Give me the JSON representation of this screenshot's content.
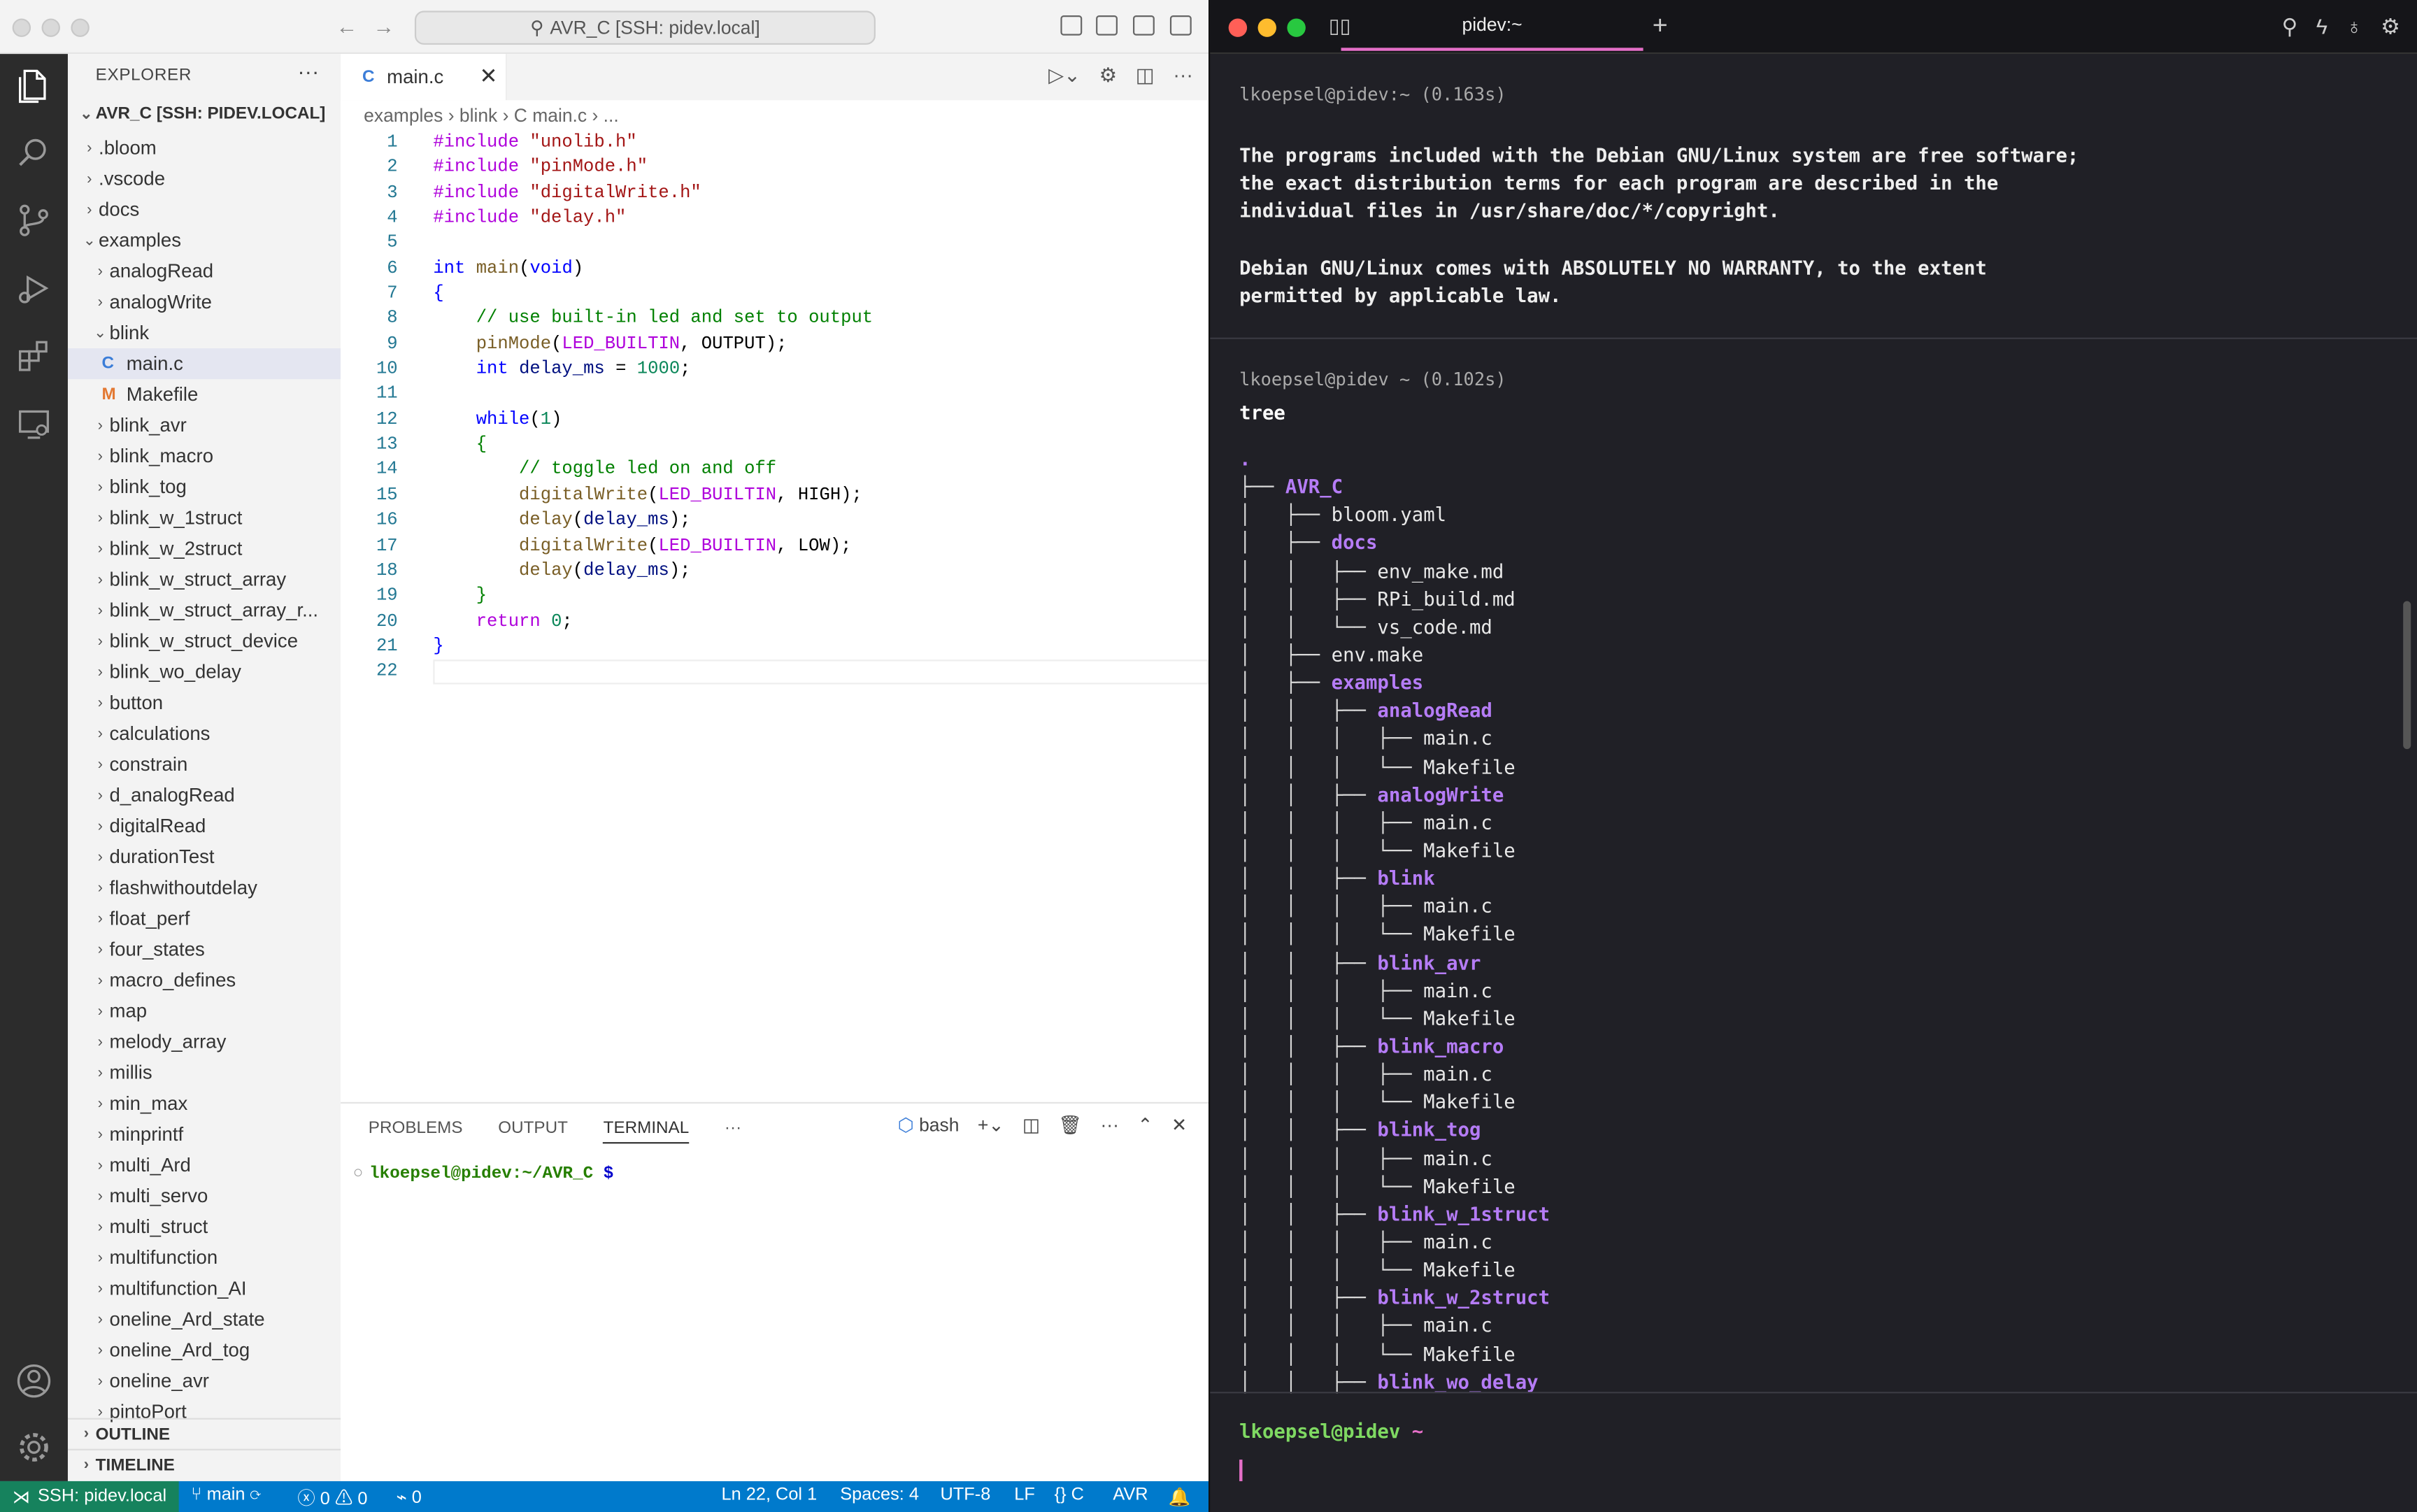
{
  "vscode": {
    "title_search": "AVR_C [SSH: pidev.local]",
    "explorer": {
      "title": "EXPLORER",
      "more": "···",
      "root": "AVR_C [SSH: PIDEV.LOCAL]",
      "items": [
        {
          "label": ".bloom",
          "chev": "›",
          "indent": 1
        },
        {
          "label": ".vscode",
          "chev": "›",
          "indent": 1
        },
        {
          "label": "docs",
          "chev": "›",
          "indent": 1
        },
        {
          "label": "examples",
          "chev": "⌄",
          "indent": 1
        },
        {
          "label": "analogRead",
          "chev": "›",
          "indent": 2
        },
        {
          "label": "analogWrite",
          "chev": "›",
          "indent": 2
        },
        {
          "label": "blink",
          "chev": "⌄",
          "indent": 2
        },
        {
          "label": "main.c",
          "icon": "C",
          "indent": 3,
          "selected": true
        },
        {
          "label": "Makefile",
          "icon": "M",
          "indent": 3
        },
        {
          "label": "blink_avr",
          "chev": "›",
          "indent": 2
        },
        {
          "label": "blink_macro",
          "chev": "›",
          "indent": 2
        },
        {
          "label": "blink_tog",
          "chev": "›",
          "indent": 2
        },
        {
          "label": "blink_w_1struct",
          "chev": "›",
          "indent": 2
        },
        {
          "label": "blink_w_2struct",
          "chev": "›",
          "indent": 2
        },
        {
          "label": "blink_w_struct_array",
          "chev": "›",
          "indent": 2
        },
        {
          "label": "blink_w_struct_array_r...",
          "chev": "›",
          "indent": 2
        },
        {
          "label": "blink_w_struct_device",
          "chev": "›",
          "indent": 2
        },
        {
          "label": "blink_wo_delay",
          "chev": "›",
          "indent": 2
        },
        {
          "label": "button",
          "chev": "›",
          "indent": 2
        },
        {
          "label": "calculations",
          "chev": "›",
          "indent": 2
        },
        {
          "label": "constrain",
          "chev": "›",
          "indent": 2
        },
        {
          "label": "d_analogRead",
          "chev": "›",
          "indent": 2
        },
        {
          "label": "digitalRead",
          "chev": "›",
          "indent": 2
        },
        {
          "label": "durationTest",
          "chev": "›",
          "indent": 2
        },
        {
          "label": "flashwithoutdelay",
          "chev": "›",
          "indent": 2
        },
        {
          "label": "float_perf",
          "chev": "›",
          "indent": 2
        },
        {
          "label": "four_states",
          "chev": "›",
          "indent": 2
        },
        {
          "label": "macro_defines",
          "chev": "›",
          "indent": 2
        },
        {
          "label": "map",
          "chev": "›",
          "indent": 2
        },
        {
          "label": "melody_array",
          "chev": "›",
          "indent": 2
        },
        {
          "label": "millis",
          "chev": "›",
          "indent": 2
        },
        {
          "label": "min_max",
          "chev": "›",
          "indent": 2
        },
        {
          "label": "minprintf",
          "chev": "›",
          "indent": 2
        },
        {
          "label": "multi_Ard",
          "chev": "›",
          "indent": 2
        },
        {
          "label": "multi_servo",
          "chev": "›",
          "indent": 2
        },
        {
          "label": "multi_struct",
          "chev": "›",
          "indent": 2
        },
        {
          "label": "multifunction",
          "chev": "›",
          "indent": 2
        },
        {
          "label": "multifunction_AI",
          "chev": "›",
          "indent": 2
        },
        {
          "label": "oneline_Ard_state",
          "chev": "›",
          "indent": 2
        },
        {
          "label": "oneline_Ard_tog",
          "chev": "›",
          "indent": 2
        },
        {
          "label": "oneline_avr",
          "chev": "›",
          "indent": 2
        },
        {
          "label": "pintoPort",
          "chev": "›",
          "indent": 2
        }
      ],
      "outline": "OUTLINE",
      "timeline": "TIMELINE"
    },
    "tab": {
      "label": "main.c",
      "icon": "C",
      "close": "✕"
    },
    "breadcrumb": "examples › blink › C main.c › ...",
    "code": [
      [
        {
          "t": "#include ",
          "c": "p"
        },
        {
          "t": "\"unolib.h\"",
          "c": "s"
        }
      ],
      [
        {
          "t": "#include ",
          "c": "p"
        },
        {
          "t": "\"pinMode.h\"",
          "c": "s"
        }
      ],
      [
        {
          "t": "#include ",
          "c": "p"
        },
        {
          "t": "\"digitalWrite.h\"",
          "c": "s"
        }
      ],
      [
        {
          "t": "#include ",
          "c": "p"
        },
        {
          "t": "\"delay.h\"",
          "c": "s"
        }
      ],
      [],
      [
        {
          "t": "int ",
          "c": "k"
        },
        {
          "t": "main",
          "c": "m"
        },
        {
          "t": "("
        },
        {
          "t": "void",
          "c": "k"
        },
        {
          "t": ")"
        }
      ],
      [
        {
          "t": "{",
          "c": "k"
        }
      ],
      [
        {
          "t": "    "
        },
        {
          "t": "// use built-in led and set to output",
          "c": "c"
        }
      ],
      [
        {
          "t": "    "
        },
        {
          "t": "pinMode",
          "c": "m"
        },
        {
          "t": "("
        },
        {
          "t": "LED_BUILTIN",
          "c": "p"
        },
        {
          "t": ", OUTPUT);"
        }
      ],
      [
        {
          "t": "    "
        },
        {
          "t": "int ",
          "c": "k"
        },
        {
          "t": "delay_ms",
          "c": "v"
        },
        {
          "t": " = "
        },
        {
          "t": "1000",
          "c": "n"
        },
        {
          "t": ";"
        }
      ],
      [],
      [
        {
          "t": "    "
        },
        {
          "t": "while",
          "c": "k"
        },
        {
          "t": "("
        },
        {
          "t": "1",
          "c": "n"
        },
        {
          "t": ")"
        }
      ],
      [
        {
          "t": "    "
        },
        {
          "t": "{",
          "c": "c"
        }
      ],
      [
        {
          "t": "        "
        },
        {
          "t": "// toggle led on and off",
          "c": "c"
        }
      ],
      [
        {
          "t": "        "
        },
        {
          "t": "digitalWrite",
          "c": "m"
        },
        {
          "t": "("
        },
        {
          "t": "LED_BUILTIN",
          "c": "p"
        },
        {
          "t": ", HIGH);"
        }
      ],
      [
        {
          "t": "        "
        },
        {
          "t": "delay",
          "c": "m"
        },
        {
          "t": "("
        },
        {
          "t": "delay_ms",
          "c": "v"
        },
        {
          "t": ");"
        }
      ],
      [
        {
          "t": "        "
        },
        {
          "t": "digitalWrite",
          "c": "m"
        },
        {
          "t": "("
        },
        {
          "t": "LED_BUILTIN",
          "c": "p"
        },
        {
          "t": ", LOW);"
        }
      ],
      [
        {
          "t": "        "
        },
        {
          "t": "delay",
          "c": "m"
        },
        {
          "t": "("
        },
        {
          "t": "delay_ms",
          "c": "v"
        },
        {
          "t": ");"
        }
      ],
      [
        {
          "t": "    "
        },
        {
          "t": "}",
          "c": "c"
        }
      ],
      [
        {
          "t": "    "
        },
        {
          "t": "return ",
          "c": "p"
        },
        {
          "t": "0",
          "c": "n"
        },
        {
          "t": ";"
        }
      ],
      [
        {
          "t": "}",
          "c": "k"
        }
      ],
      []
    ],
    "panel": {
      "tabs": [
        "PROBLEMS",
        "OUTPUT",
        "TERMINAL"
      ],
      "more": "···",
      "shell": "bash",
      "prompt_user": "lkoepsel@pidev:~/AVR_C",
      "prompt_sign": " $"
    },
    "status": {
      "remote": "SSH: pidev.local",
      "branch": "main",
      "errors": "0",
      "warnings": "0",
      "ports": "0",
      "position": "Ln 22, Col 1",
      "spaces": "Spaces: 4",
      "encoding": "UTF-8",
      "eol": "LF",
      "language": "C",
      "config": "AVR"
    }
  },
  "terminal": {
    "tab": "pidev:~",
    "block1_header": "lkoepsel@pidev:~ (0.163s)",
    "block1_text": "The programs included with the Debian GNU/Linux system are free software;\nthe exact distribution terms for each program are described in the\nindividual files in /usr/share/doc/*/copyright.\n\nDebian GNU/Linux comes with ABSOLUTELY NO WARRANTY, to the extent\npermitted by applicable law.",
    "block2_header": "lkoepsel@pidev ~ (0.102s)",
    "block2_cmd": "tree",
    "tree": [
      {
        "g": "",
        "n": ".",
        "d": true
      },
      {
        "g": "├── ",
        "n": "AVR_C",
        "d": true
      },
      {
        "g": "│   ├── ",
        "n": "bloom.yaml"
      },
      {
        "g": "│   ├── ",
        "n": "docs",
        "d": true
      },
      {
        "g": "│   │   ├── ",
        "n": "env_make.md"
      },
      {
        "g": "│   │   ├── ",
        "n": "RPi_build.md"
      },
      {
        "g": "│   │   └── ",
        "n": "vs_code.md"
      },
      {
        "g": "│   ├── ",
        "n": "env.make"
      },
      {
        "g": "│   ├── ",
        "n": "examples",
        "d": true
      },
      {
        "g": "│   │   ├── ",
        "n": "analogRead",
        "d": true
      },
      {
        "g": "│   │   │   ├── ",
        "n": "main.c"
      },
      {
        "g": "│   │   │   └── ",
        "n": "Makefile"
      },
      {
        "g": "│   │   ├── ",
        "n": "analogWrite",
        "d": true
      },
      {
        "g": "│   │   │   ├── ",
        "n": "main.c"
      },
      {
        "g": "│   │   │   └── ",
        "n": "Makefile"
      },
      {
        "g": "│   │   ├── ",
        "n": "blink",
        "d": true
      },
      {
        "g": "│   │   │   ├── ",
        "n": "main.c"
      },
      {
        "g": "│   │   │   └── ",
        "n": "Makefile"
      },
      {
        "g": "│   │   ├── ",
        "n": "blink_avr",
        "d": true
      },
      {
        "g": "│   │   │   ├── ",
        "n": "main.c"
      },
      {
        "g": "│   │   │   └── ",
        "n": "Makefile"
      },
      {
        "g": "│   │   ├── ",
        "n": "blink_macro",
        "d": true
      },
      {
        "g": "│   │   │   ├── ",
        "n": "main.c"
      },
      {
        "g": "│   │   │   └── ",
        "n": "Makefile"
      },
      {
        "g": "│   │   ├── ",
        "n": "blink_tog",
        "d": true
      },
      {
        "g": "│   │   │   ├── ",
        "n": "main.c"
      },
      {
        "g": "│   │   │   └── ",
        "n": "Makefile"
      },
      {
        "g": "│   │   ├── ",
        "n": "blink_w_1struct",
        "d": true
      },
      {
        "g": "│   │   │   ├── ",
        "n": "main.c"
      },
      {
        "g": "│   │   │   └── ",
        "n": "Makefile"
      },
      {
        "g": "│   │   ├── ",
        "n": "blink_w_2struct",
        "d": true
      },
      {
        "g": "│   │   │   ├── ",
        "n": "main.c"
      },
      {
        "g": "│   │   │   └── ",
        "n": "Makefile"
      },
      {
        "g": "│   │   ├── ",
        "n": "blink_wo_delay",
        "d": true
      }
    ],
    "prompt_user": "lkoepsel@pidev",
    "prompt_tilde": " ~"
  }
}
